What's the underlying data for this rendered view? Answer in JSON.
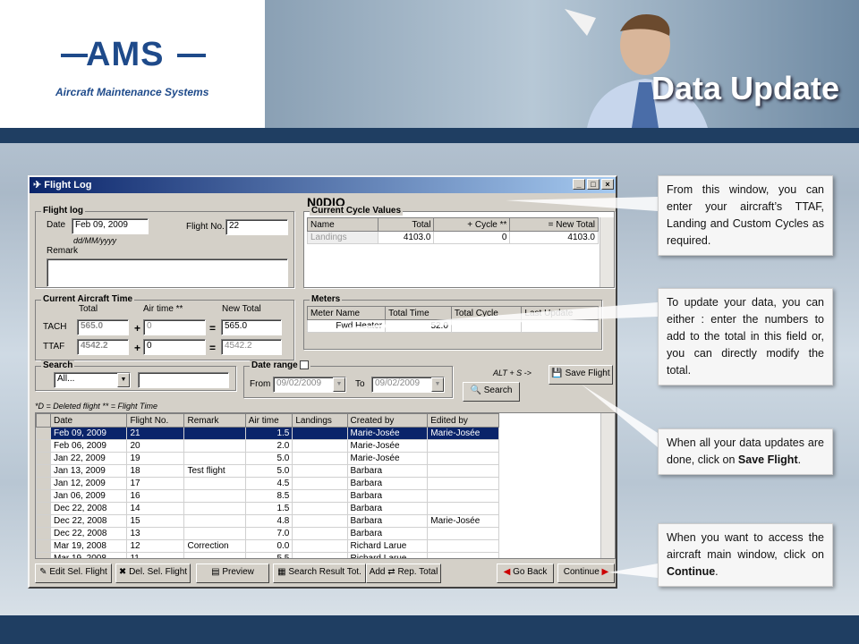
{
  "header": {
    "logo": "AMS",
    "logo_sub": "Aircraft Maintenance Systems",
    "title": "Data Update"
  },
  "window": {
    "title": "Flight Log",
    "btn_min": "_",
    "btn_max": "□",
    "btn_close": "×",
    "registration": "N0DIO"
  },
  "flight_log": {
    "legend": "Flight log",
    "date_label": "Date",
    "date_value": "Feb 09, 2009",
    "date_hint": "dd/MM/yyyy",
    "flight_no_label": "Flight No.",
    "flight_no_value": "22",
    "remark_label": "Remark"
  },
  "cycles": {
    "legend": "Current Cycle Values",
    "headers": [
      "Name",
      "Total",
      "+ Cycle **",
      "= New Total"
    ],
    "rows": [
      [
        "Landings",
        "4103.0",
        "0",
        "4103.0"
      ]
    ]
  },
  "aircraft_time": {
    "legend": "Current Aircraft Time",
    "col_total": "Total",
    "col_air": "Air time **",
    "col_new": "New Total",
    "tach_label": "TACH",
    "tach_total": "565.0",
    "tach_air": "0",
    "tach_new": "565.0",
    "ttaf_label": "TTAF",
    "ttaf_total": "4542.2",
    "ttaf_air": "0",
    "ttaf_new": "4542.2",
    "plus": "+",
    "eq": "="
  },
  "meters": {
    "legend": "Meters",
    "headers": [
      "Meter Name",
      "Total Time",
      "Total Cycle",
      "Last Update"
    ],
    "rows": [
      [
        "Fwd Heater",
        "52.0",
        "",
        ""
      ]
    ]
  },
  "search": {
    "legend": "Search",
    "select_value": "All...",
    "date_range_label": "Date range",
    "from_label": "From",
    "from_value": "09/02/2009",
    "to_label": "To",
    "to_value": "09/02/2009",
    "shortcut": "ALT + S ->",
    "save_flight": "Save Flight",
    "search_btn": "Search"
  },
  "legend_note": "*D = Deleted flight     ** = Flight Time",
  "flights": {
    "headers": [
      "Date",
      "Flight No.",
      "Remark",
      "Air time",
      "Landings",
      "Created by",
      "Edited by"
    ],
    "rows": [
      [
        "Feb 09, 2009",
        "21",
        "",
        "1.5",
        "",
        "Marie-Josée",
        "Marie-Josée"
      ],
      [
        "Feb 06, 2009",
        "20",
        "",
        "2.0",
        "",
        "Marie-Josée",
        ""
      ],
      [
        "Jan 22, 2009",
        "19",
        "",
        "5.0",
        "",
        "Marie-Josée",
        ""
      ],
      [
        "Jan 13, 2009",
        "18",
        "Test flight",
        "5.0",
        "",
        "Barbara",
        ""
      ],
      [
        "Jan 12, 2009",
        "17",
        "",
        "4.5",
        "",
        "Barbara",
        ""
      ],
      [
        "Jan 06, 2009",
        "16",
        "",
        "8.5",
        "",
        "Barbara",
        ""
      ],
      [
        "Dec 22, 2008",
        "14",
        "",
        "1.5",
        "",
        "Barbara",
        ""
      ],
      [
        "Dec 22, 2008",
        "15",
        "",
        "4.8",
        "",
        "Barbara",
        "Marie-Josée"
      ],
      [
        "Dec 22, 2008",
        "13",
        "",
        "7.0",
        "",
        "Barbara",
        ""
      ],
      [
        "Mar 19, 2008",
        "12",
        "Correction",
        "0.0",
        "",
        "Richard Larue",
        ""
      ],
      [
        "Mar 19, 2008",
        "11",
        "",
        "5.5",
        "",
        "Richard Larue",
        ""
      ]
    ]
  },
  "bottom_buttons": {
    "edit": "Edit Sel. Flight",
    "del": "Del. Sel. Flight",
    "preview": "Preview",
    "search_tot": "Search Result Tot.",
    "add": "Add",
    "rep": "Rep. Total",
    "go_back": "Go Back",
    "continue": "Continue"
  },
  "callouts": {
    "c1": "From this window, you can enter your aircraft’s TTAF, Landing and Custom Cycles as required.",
    "c2": "To update your data, you can either : enter the numbers to add to the total in this field or, you can directly modify the total.",
    "c3_pre": "When all your data updates are done, click on ",
    "c3_b": "Save Flight",
    "c3_post": ".",
    "c4_pre": "When you want to access the aircraft main window, click on ",
    "c4_b": "Continue",
    "c4_post": "."
  },
  "colors": {
    "accent": "#1f3e62",
    "selection": "#0a246a"
  }
}
